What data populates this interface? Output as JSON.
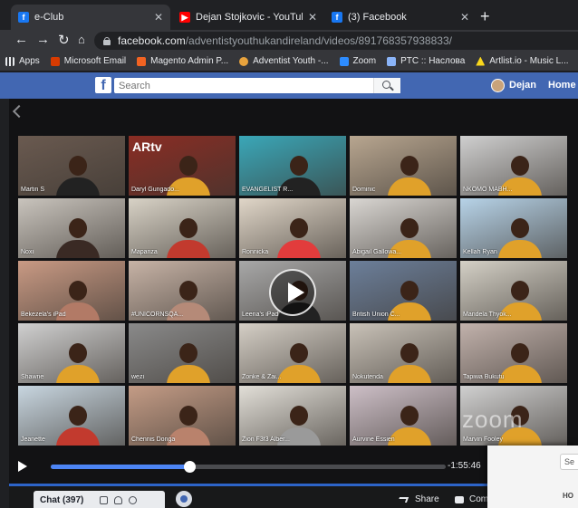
{
  "browser": {
    "tabs": [
      {
        "title": "e-Club",
        "favicon": "facebook-icon",
        "active": true
      },
      {
        "title": "Dejan Stojkovic - YouTube",
        "favicon": "youtube-icon",
        "active": false
      },
      {
        "title": "(3) Facebook",
        "favicon": "facebook-icon",
        "active": false
      }
    ],
    "address": {
      "host": "facebook.com",
      "path": "/adventistyouthukandireland/videos/891768357938833/"
    },
    "bookmarks": [
      {
        "label": "Apps",
        "color": "#e8eaed"
      },
      {
        "label": "Microsoft Email",
        "color": "#d83b01"
      },
      {
        "label": "Magento Admin P...",
        "color": "#f26322"
      },
      {
        "label": "Adventist Youth -...",
        "color": "#e8a33d"
      },
      {
        "label": "Zoom",
        "color": "#2d8cff"
      },
      {
        "label": "PTC :: Наслова",
        "color": "#8ab4f8"
      },
      {
        "label": "Artlist.io - Music L...",
        "color": "#f9d71c"
      }
    ]
  },
  "facebook": {
    "logo": "f",
    "search_placeholder": "Search",
    "user_name": "Dejan",
    "home_label": "Home"
  },
  "video": {
    "participants": [
      {
        "name": "Martin S",
        "wall": "#6a5a50",
        "shirt": "#222222"
      },
      {
        "name": "Daryl Gungado...",
        "wall": "#8a2d24",
        "shirt": "#e0a12a"
      },
      {
        "name": "EVANGELIST R...",
        "wall": "#3aa7b8",
        "shirt": "#222222"
      },
      {
        "name": "Dominic",
        "wall": "#b8a690",
        "shirt": "#e0a12a"
      },
      {
        "name": "NKOMO MABH...",
        "wall": "#cfcfcf",
        "shirt": "#e0a12a"
      },
      {
        "name": "Noxi",
        "wall": "#c9c4bd",
        "shirt": "#3a2a24"
      },
      {
        "name": "Mapanza",
        "wall": "#d8d2c6",
        "shirt": "#c23a2e"
      },
      {
        "name": "Ronnicka",
        "wall": "#e0d6c8",
        "shirt": "#e23c3c"
      },
      {
        "name": "Abigail Gallowa...",
        "wall": "#d9d6d2",
        "shirt": "#e0a12a"
      },
      {
        "name": "Kellah Ryan",
        "wall": "#b7d3e8",
        "shirt": "#e0a12a"
      },
      {
        "name": "Bekezela's iPad",
        "wall": "#c99a84",
        "shirt": "#b27a66"
      },
      {
        "name": "#UNICORNSQA...",
        "wall": "#c7b3a6",
        "shirt": "#b58a78"
      },
      {
        "name": "Leena's iPad",
        "wall": "#a8a8a8",
        "shirt": "#222222"
      },
      {
        "name": "British Union C...",
        "wall": "#6c7f9a",
        "shirt": "#e0a12a"
      },
      {
        "name": "Mandela Thyok...",
        "wall": "#d4d0c6",
        "shirt": "#e0a12a"
      },
      {
        "name": "Shawne",
        "wall": "#d0d0d0",
        "shirt": "#e0a12a"
      },
      {
        "name": "wezi",
        "wall": "#8a8a8a",
        "shirt": "#e0a12a"
      },
      {
        "name": "Zonke & Zai...",
        "wall": "#d5cfc6",
        "shirt": "#e0a12a"
      },
      {
        "name": "Nokutenda",
        "wall": "#c9c2b8",
        "shirt": "#e0a12a"
      },
      {
        "name": "Tapiwa Bukutu",
        "wall": "#c2b2ac",
        "shirt": "#e0a12a"
      },
      {
        "name": "Jeanette",
        "wall": "#c8d6e0",
        "shirt": "#c23a2e"
      },
      {
        "name": "Chennis Donga",
        "wall": "#c49c86",
        "shirt": "#b9826c"
      },
      {
        "name": "Zion F3f3 Alber...",
        "wall": "#e2dfd8",
        "shirt": "#9a9a9a"
      },
      {
        "name": "Aurvine Essien",
        "wall": "#cdbfc7",
        "shirt": "#e0a12a"
      },
      {
        "name": "Marvin Fooley",
        "wall": "#d0d0d0",
        "shirt": "#e0a12a"
      }
    ],
    "tile_art_text": "ARtv",
    "watermark": "zoom",
    "progress_fraction": 0.35,
    "time_remaining": "-1:55:46"
  },
  "bottom": {
    "chat_label": "Chat (397)",
    "share_label": "Share",
    "comment_label": "Com"
  },
  "overlay_paper": {
    "search_text": "Se",
    "label": "HO"
  }
}
